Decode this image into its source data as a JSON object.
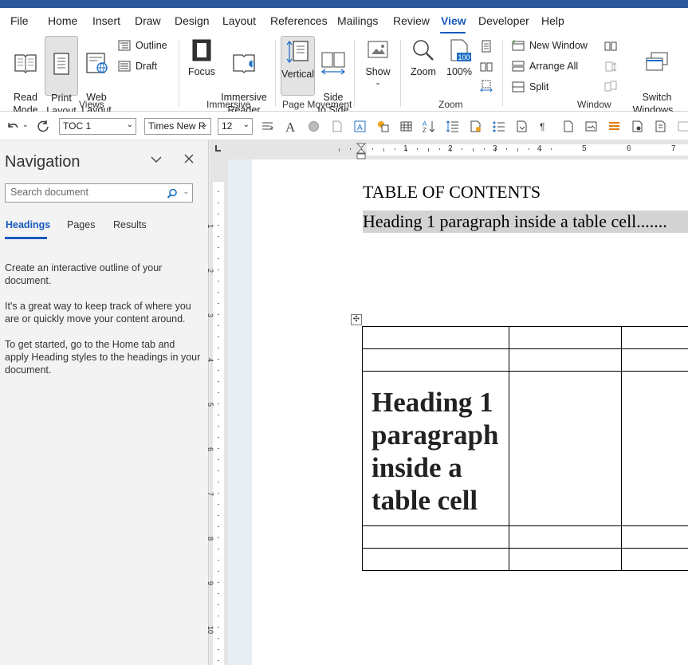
{
  "menu": [
    "File",
    "Home",
    "Insert",
    "Draw",
    "Design",
    "Layout",
    "References",
    "Mailings",
    "Review",
    "View",
    "Developer",
    "Help"
  ],
  "active_menu": "View",
  "ribbon": {
    "views": {
      "read_mode": "Read\nMode",
      "print_layout": "Print\nLayout",
      "web_layout": "Web\nLayout",
      "outline": "Outline",
      "draft": "Draft",
      "label": "Views"
    },
    "immersive": {
      "focus": "Focus",
      "reader": "Immersive\nReader",
      "label": "Immersive"
    },
    "page_movement": {
      "vertical": "Vertical",
      "side_to_side": "Side\nto Side",
      "label": "Page Movement"
    },
    "show": {
      "show": "Show"
    },
    "zoom": {
      "zoom": "Zoom",
      "hundred": "100%",
      "label": "Zoom",
      "badge": "100"
    },
    "window": {
      "new_window": "New Window",
      "arrange_all": "Arrange All",
      "split": "Split",
      "switch": "Switch\nWindows",
      "label": "Window"
    }
  },
  "toolbar": {
    "style": "TOC 1",
    "font": "Times New R",
    "size": "12"
  },
  "navigation": {
    "title": "Navigation",
    "search_placeholder": "Search document",
    "tabs": [
      "Headings",
      "Pages",
      "Results"
    ],
    "p1": "Create an interactive outline of your document.",
    "p2": "It's a great way to keep track of where you are or quickly move your content around.",
    "p3": "To get started, go to the Home tab and apply Heading styles to the headings in your document."
  },
  "document": {
    "toc_title": "TABLE OF CONTENTS",
    "toc_entry": "Heading 1 paragraph inside a table cell.......",
    "cell_heading": "Heading 1 paragraph inside a table cell"
  },
  "ruler": {
    "h_numbers": [
      "1",
      "2",
      "3",
      "4",
      "5",
      "6",
      "7"
    ],
    "v_numbers": [
      "1",
      "2",
      "3",
      "4",
      "5",
      "6",
      "7",
      "8",
      "9",
      "10"
    ]
  }
}
